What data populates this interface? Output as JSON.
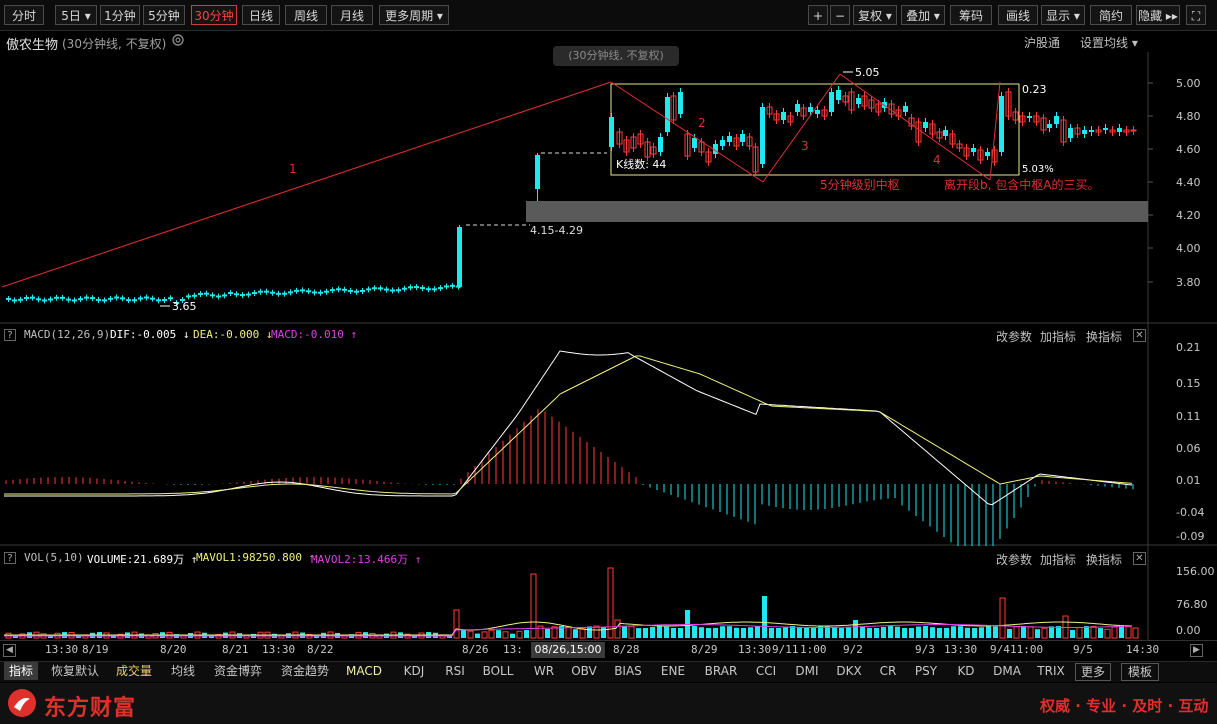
{
  "toolbar": {
    "periods": [
      {
        "label": "分时"
      },
      {
        "label": "5日 ▾"
      },
      {
        "label": "1分钟"
      },
      {
        "label": "5分钟"
      },
      {
        "label": "30分钟",
        "active": true
      },
      {
        "label": "日线"
      },
      {
        "label": "周线"
      },
      {
        "label": "月线"
      },
      {
        "label": "更多周期 ▾"
      }
    ],
    "right": [
      {
        "label": "+"
      },
      {
        "label": "−"
      },
      {
        "label": "复权 ▾"
      },
      {
        "label": "叠加 ▾"
      },
      {
        "label": "筹码"
      },
      {
        "label": "画线"
      },
      {
        "label": "显示 ▾"
      },
      {
        "label": "简约"
      },
      {
        "label": "隐藏 ▸▸"
      },
      {
        "label": "⛶"
      }
    ]
  },
  "stock": {
    "name": "傲农生物",
    "period_info": "(30分钟线, 不复权)",
    "market": "沪股通",
    "ma_setting": "设置均线 ▾",
    "watermark": "(30分钟线, 不复权)"
  },
  "price_chart": {
    "y_ticks": [
      "5.00",
      "4.80",
      "4.60",
      "4.40",
      "4.20",
      "4.00",
      "3.80"
    ],
    "annotations": {
      "seg1": "1",
      "seg2": "2",
      "seg3": "3",
      "seg4": "4",
      "high_label": "5.05",
      "low_label": "3.65",
      "zone_label": "4.15-4.29",
      "box_high": "0.23",
      "box_pct": "5.03%",
      "kcount": "K线数: 44",
      "center_label": "5分钟级别中枢",
      "leave_label": "离开段b, 包含中枢A的三买。"
    }
  },
  "macd": {
    "label": "MACD(12,26,9)",
    "dif": "DIF:-0.005 ↓",
    "dea": "DEA:-0.000 ↓",
    "macd": "MACD:-0.010 ↑",
    "y_ticks": [
      "0.21",
      "0.15",
      "0.11",
      "0.06",
      "0.01",
      "-0.04",
      "-0.09"
    ],
    "actions": [
      "改参数",
      "加指标",
      "换指标"
    ]
  },
  "vol": {
    "label": "VOL(5,10)",
    "volume": "VOLUME:21.689万 ↑",
    "mavol1": "MAVOL1:98250.800 ↑",
    "mavol2": "MAVOL2:13.466万 ↑",
    "y_ticks": [
      "156.00",
      "76.80",
      "0.00"
    ],
    "actions": [
      "改参数",
      "加指标",
      "换指标"
    ]
  },
  "time_axis": {
    "labels": [
      "13:30",
      "8/19",
      "8/20",
      "8/21",
      "13:30",
      "8/22",
      "8/26",
      "13:",
      "8/28",
      "8/29",
      "13:30",
      "9/11",
      "1:00",
      "9/2",
      "9/3",
      "13:30",
      "9/4",
      "11:00",
      "9/5",
      "14:30"
    ],
    "cursor": "08/26,15:00"
  },
  "bottom_tabs": [
    {
      "label": "指标",
      "active": true
    },
    {
      "label": "恢复默认"
    },
    {
      "label": "成交量",
      "active": true
    },
    {
      "label": "均线"
    },
    {
      "label": "资金博弈"
    },
    {
      "label": "资金趋势"
    },
    {
      "label": "MACD",
      "active": true
    },
    {
      "label": "KDJ"
    },
    {
      "label": "RSI"
    },
    {
      "label": "BOLL"
    },
    {
      "label": "WR"
    },
    {
      "label": "OBV"
    },
    {
      "label": "BIAS"
    },
    {
      "label": "ENE"
    },
    {
      "label": "BRAR"
    },
    {
      "label": "CCI"
    },
    {
      "label": "DMI"
    },
    {
      "label": "DKX"
    },
    {
      "label": "CR"
    },
    {
      "label": "PSY"
    },
    {
      "label": "KD"
    },
    {
      "label": "DMA"
    },
    {
      "label": "TRIX"
    },
    {
      "label": "更多"
    },
    {
      "label": "模板"
    }
  ],
  "footer": {
    "brand": "东方财富",
    "slogan": "权威 · 专业 · 及时 · 互动"
  },
  "colors": {
    "up": "#ff3b3b",
    "down": "#1ee8f0",
    "yellow": "#f0f080",
    "magenta": "#e040e0",
    "bg": "#000000"
  }
}
